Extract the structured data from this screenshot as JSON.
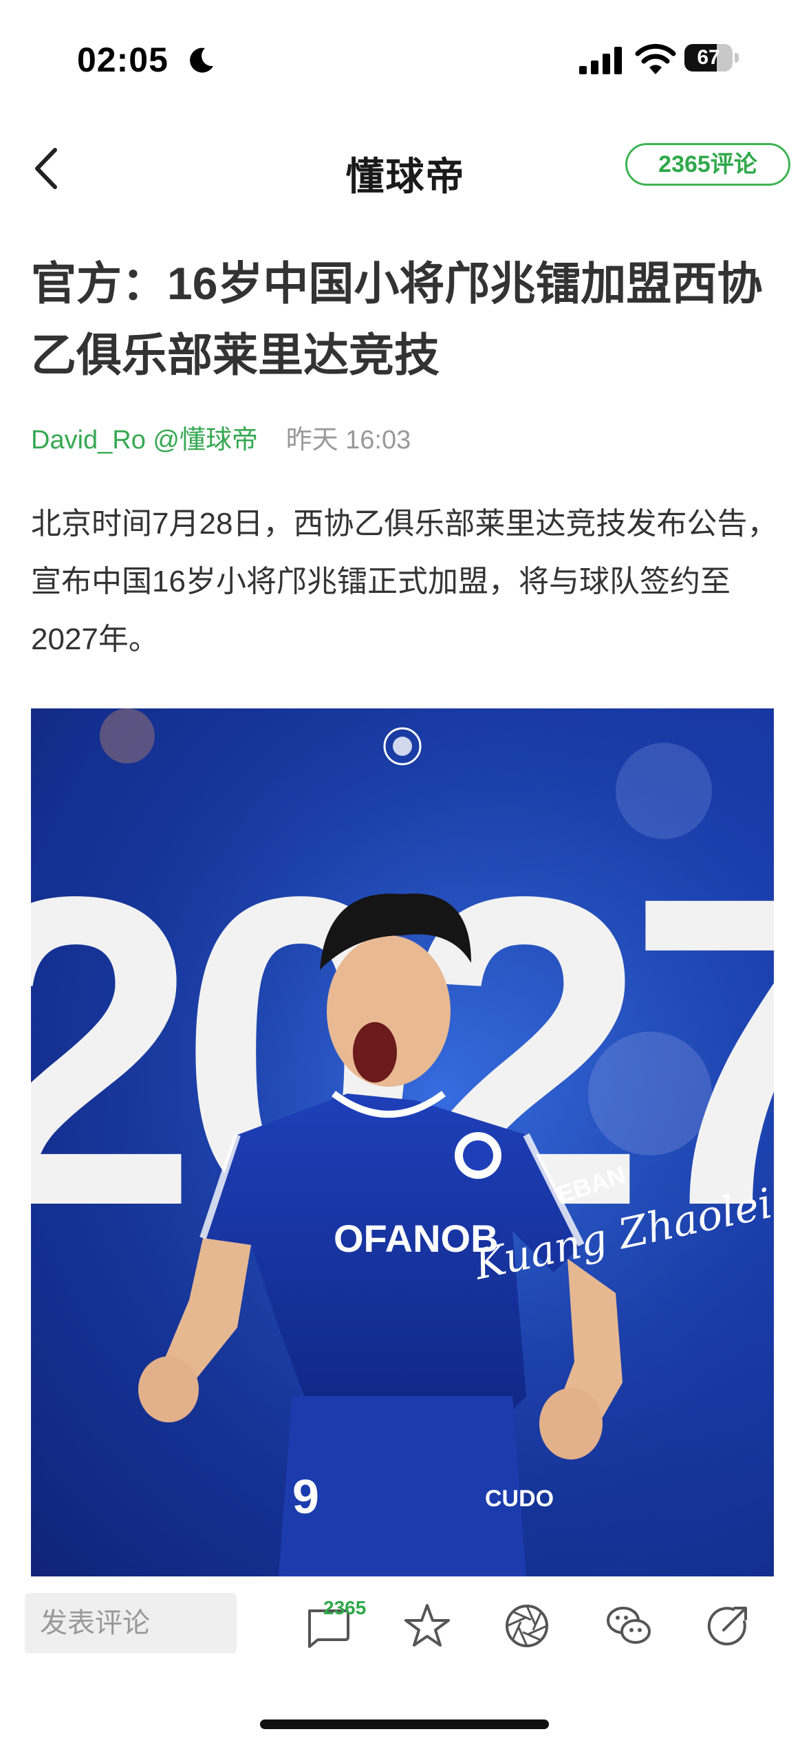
{
  "status_bar": {
    "time": "02:05",
    "battery": "67",
    "battery_level": 0.67
  },
  "nav": {
    "title": "懂球帝",
    "comments_button": "2365评论"
  },
  "article": {
    "title": "官方：16岁中国小将邝兆镭加盟西协乙俱乐部莱里达竞技",
    "author": "David_Ro @懂球帝",
    "time": "昨天 16:03",
    "body": "北京时间7月28日，西协乙俱乐部莱里达竞技发布公告，宣布中国16岁小将邝兆镭正式加盟，将与球队签约至2027年。"
  },
  "image": {
    "big_number": "2027",
    "sponsor": "EBAN",
    "shirt_text": "OFANOB",
    "shorts_text": "CUDO",
    "shirt_number": "9",
    "signature": "Kuang Zhaolei"
  },
  "bottom_bar": {
    "comment_placeholder": "发表评论",
    "comment_count": "2365"
  },
  "colors": {
    "accent": "#2fa84a",
    "image_blue": "#1a3fb0"
  }
}
